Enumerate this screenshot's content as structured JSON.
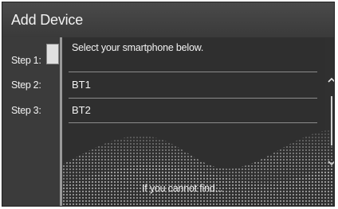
{
  "header": {
    "title": "Add Device"
  },
  "steps": [
    {
      "label": "Step 1:"
    },
    {
      "label": "Step 2:"
    },
    {
      "label": "Step 3:"
    }
  ],
  "main": {
    "instruction": "Select your smartphone below.",
    "devices": [
      {
        "name": "BT1"
      },
      {
        "name": "BT2"
      }
    ],
    "help_link": "If you cannot find..."
  },
  "icons": {
    "scroll_up": "chevron-up-icon",
    "scroll_down": "chevron-down-icon"
  },
  "colors": {
    "background": "#303030",
    "text": "#f2f2f2",
    "divider": "#8c8c8c"
  }
}
